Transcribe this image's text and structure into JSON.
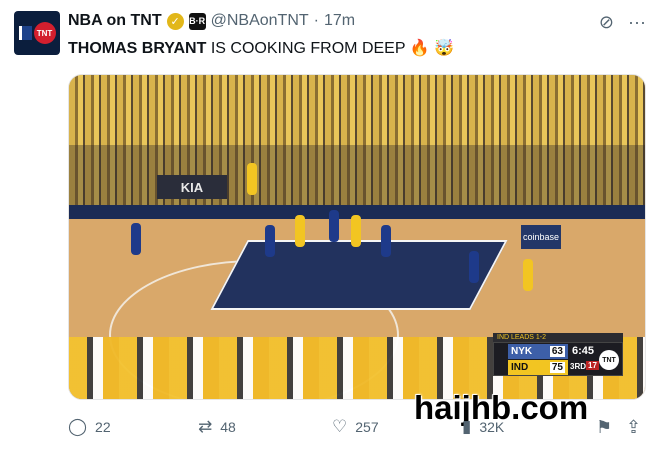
{
  "account": {
    "display_name": "NBA on TNT",
    "handle": "@NBAonTNT",
    "separator": "·",
    "time": "17m",
    "avatar_text": "TNT",
    "verified_icon": "verified-badge-icon",
    "affiliate_badge_text": "B·R"
  },
  "tweet": {
    "name_bold": "THOMAS BRYANT",
    "text_rest": " IS COOKING FROM DEEP",
    "emoji_1": "🔥",
    "emoji_2": "🤯"
  },
  "media": {
    "banner_text": "KIA",
    "stanchion_text": "coinbase",
    "scorebug": {
      "header": "IND LEADS 1-2",
      "team1": "NYK",
      "score1": "63",
      "team2": "IND",
      "score2": "75",
      "clock": "6:45",
      "quarter": "3RD",
      "timeouts": "17",
      "network": "TNT"
    }
  },
  "actions": {
    "replies": "22",
    "reposts": "48",
    "likes": "257",
    "views": "32K"
  },
  "watermark": "haijhb.com",
  "colors": {
    "text": "#0f1419",
    "muted": "#536471",
    "knicks_blue": "#1e3a8a",
    "pacers_gold": "#f2c522"
  }
}
